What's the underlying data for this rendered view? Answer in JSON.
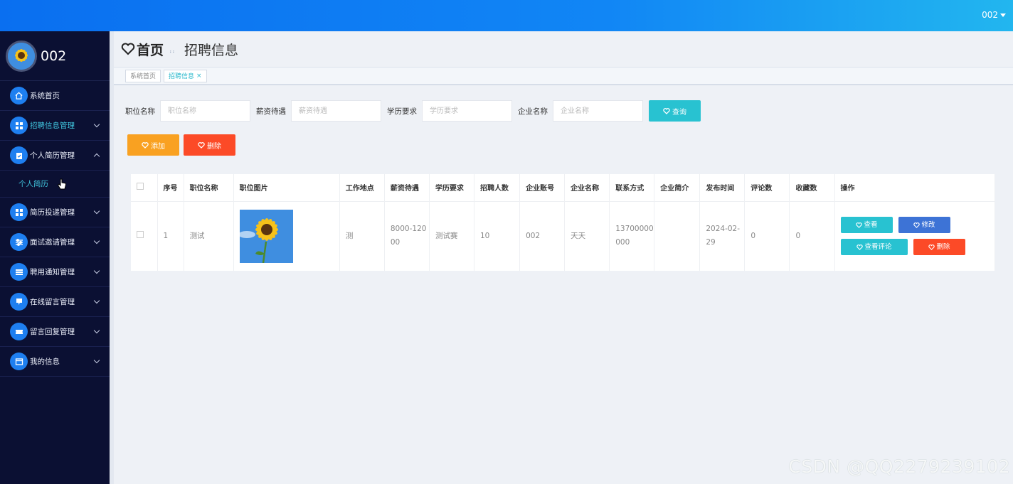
{
  "topbar": {
    "user": "002"
  },
  "sidebar": {
    "profile_name": "002",
    "items": [
      {
        "label": "系统首页",
        "icon": "home-icon",
        "expandable": false
      },
      {
        "label": "招聘信息管理",
        "icon": "grid-icon",
        "expandable": true,
        "active": true
      },
      {
        "label": "个人简历管理",
        "icon": "clipboard-icon",
        "expandable": true,
        "expanded": true,
        "sub": [
          "个人简历"
        ]
      },
      {
        "label": "简历投递管理",
        "icon": "grid-icon",
        "expandable": true
      },
      {
        "label": "面试邀请管理",
        "icon": "sliders-icon",
        "expandable": true
      },
      {
        "label": "聘用通知管理",
        "icon": "list-icon",
        "expandable": true
      },
      {
        "label": "在线留言管理",
        "icon": "message-icon",
        "expandable": true
      },
      {
        "label": "留言回复管理",
        "icon": "ticket-icon",
        "expandable": true
      },
      {
        "label": "我的信息",
        "icon": "window-icon",
        "expandable": true
      }
    ]
  },
  "header": {
    "home": "首页",
    "page": "招聘信息"
  },
  "tabs": [
    {
      "label": "系统首页"
    },
    {
      "label": "招聘信息",
      "closable": true
    }
  ],
  "search": {
    "fields": [
      {
        "label": "职位名称",
        "placeholder": "职位名称"
      },
      {
        "label": "薪资待遇",
        "placeholder": "薪资待遇"
      },
      {
        "label": "学历要求",
        "placeholder": "学历要求"
      },
      {
        "label": "企业名称",
        "placeholder": "企业名称"
      }
    ],
    "query_label": "查询"
  },
  "actions": {
    "add_label": "添加",
    "delete_label": "删除"
  },
  "table": {
    "headers": [
      "序号",
      "职位名称",
      "职位图片",
      "工作地点",
      "薪资待遇",
      "学历要求",
      "招聘人数",
      "企业账号",
      "企业名称",
      "联系方式",
      "企业简介",
      "发布时间",
      "评论数",
      "收藏数",
      "操作"
    ],
    "rows": [
      {
        "index": "1",
        "title": "测试",
        "location": "测",
        "salary": "8000-12000",
        "education": "测试赛",
        "count": "10",
        "account": "002",
        "company": "天天",
        "phone": "13700000000",
        "intro": "",
        "date": "2024-02-29",
        "comments": "0",
        "favorites": "0"
      }
    ],
    "ops": {
      "view": "查看",
      "edit": "修改",
      "comments": "查看评论",
      "delete": "删除"
    }
  },
  "watermark": "CSDN @QQ2279239102",
  "colors": {
    "accent": "#28c2d1",
    "sidebar_bg": "#0b1033",
    "topbar": "#0a6ff0",
    "add": "#f9a121",
    "delete": "#fc4a27",
    "edit": "#3d73d6"
  }
}
